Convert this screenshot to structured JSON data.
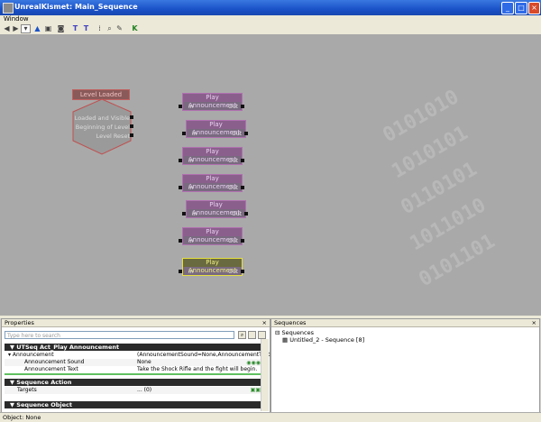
{
  "window": {
    "title": "UnrealKismet: Main_Sequence",
    "icon": "app-icon"
  },
  "menu": {
    "items": [
      "Window"
    ]
  },
  "toolbar": {
    "icons": [
      "back-arrow-icon",
      "forward-arrow-icon",
      "dropdown-icon",
      "up-arrow-icon",
      "parent-sequence-icon",
      "screenshot-icon",
      "rename-icon",
      "tidy-icon",
      "search-properties-icon",
      "zoom-icon",
      "link-icon",
      "kismet-icon"
    ]
  },
  "canvas": {
    "event": {
      "title": "Level Loaded",
      "outputs": [
        "Loaded and Visible",
        "Beginning of Level",
        "Level Reset"
      ]
    },
    "actions": [
      {
        "title": "Play Announcement",
        "in": "In",
        "out": "Out",
        "selected": false
      },
      {
        "title": "Play Announcement",
        "in": "In",
        "out": "Out",
        "selected": false
      },
      {
        "title": "Play Announcement",
        "in": "In",
        "out": "Out",
        "selected": false
      },
      {
        "title": "Play Announcement",
        "in": "In",
        "out": "Out",
        "selected": false
      },
      {
        "title": "Play Announcement",
        "in": "In",
        "out": "Out",
        "selected": false
      },
      {
        "title": "Play Announcement",
        "in": "In",
        "out": "Out",
        "selected": false
      },
      {
        "title": "Play Announcement",
        "in": "In",
        "out": "Out",
        "selected": true
      }
    ]
  },
  "properties": {
    "title": "Properties",
    "search_placeholder": "Type here to search",
    "section1": "UTSeq Act_Play Announcement",
    "announcement_key": "Announcement",
    "announcement_val": "(AnnouncementSound=None,AnnouncementText=)",
    "sound_key": "Announcement Sound",
    "sound_val": "None",
    "text_key": "Announcement Text",
    "text_val": "Take the Shock Rifle and the fight will begin.",
    "section2": "Sequence Action",
    "targets_key": "Targets",
    "targets_val": "... (0)",
    "section3": "Sequence Object"
  },
  "sequences": {
    "title": "Sequences",
    "root": "Sequences",
    "child": "Untitled_2 - Sequence [8]"
  },
  "status": {
    "text": "Object: None"
  },
  "colors": {
    "titlebar": "#1a52c8",
    "canvas": "#a9a9a9",
    "node": "#8a5f8c",
    "selected": "#e6e040"
  }
}
